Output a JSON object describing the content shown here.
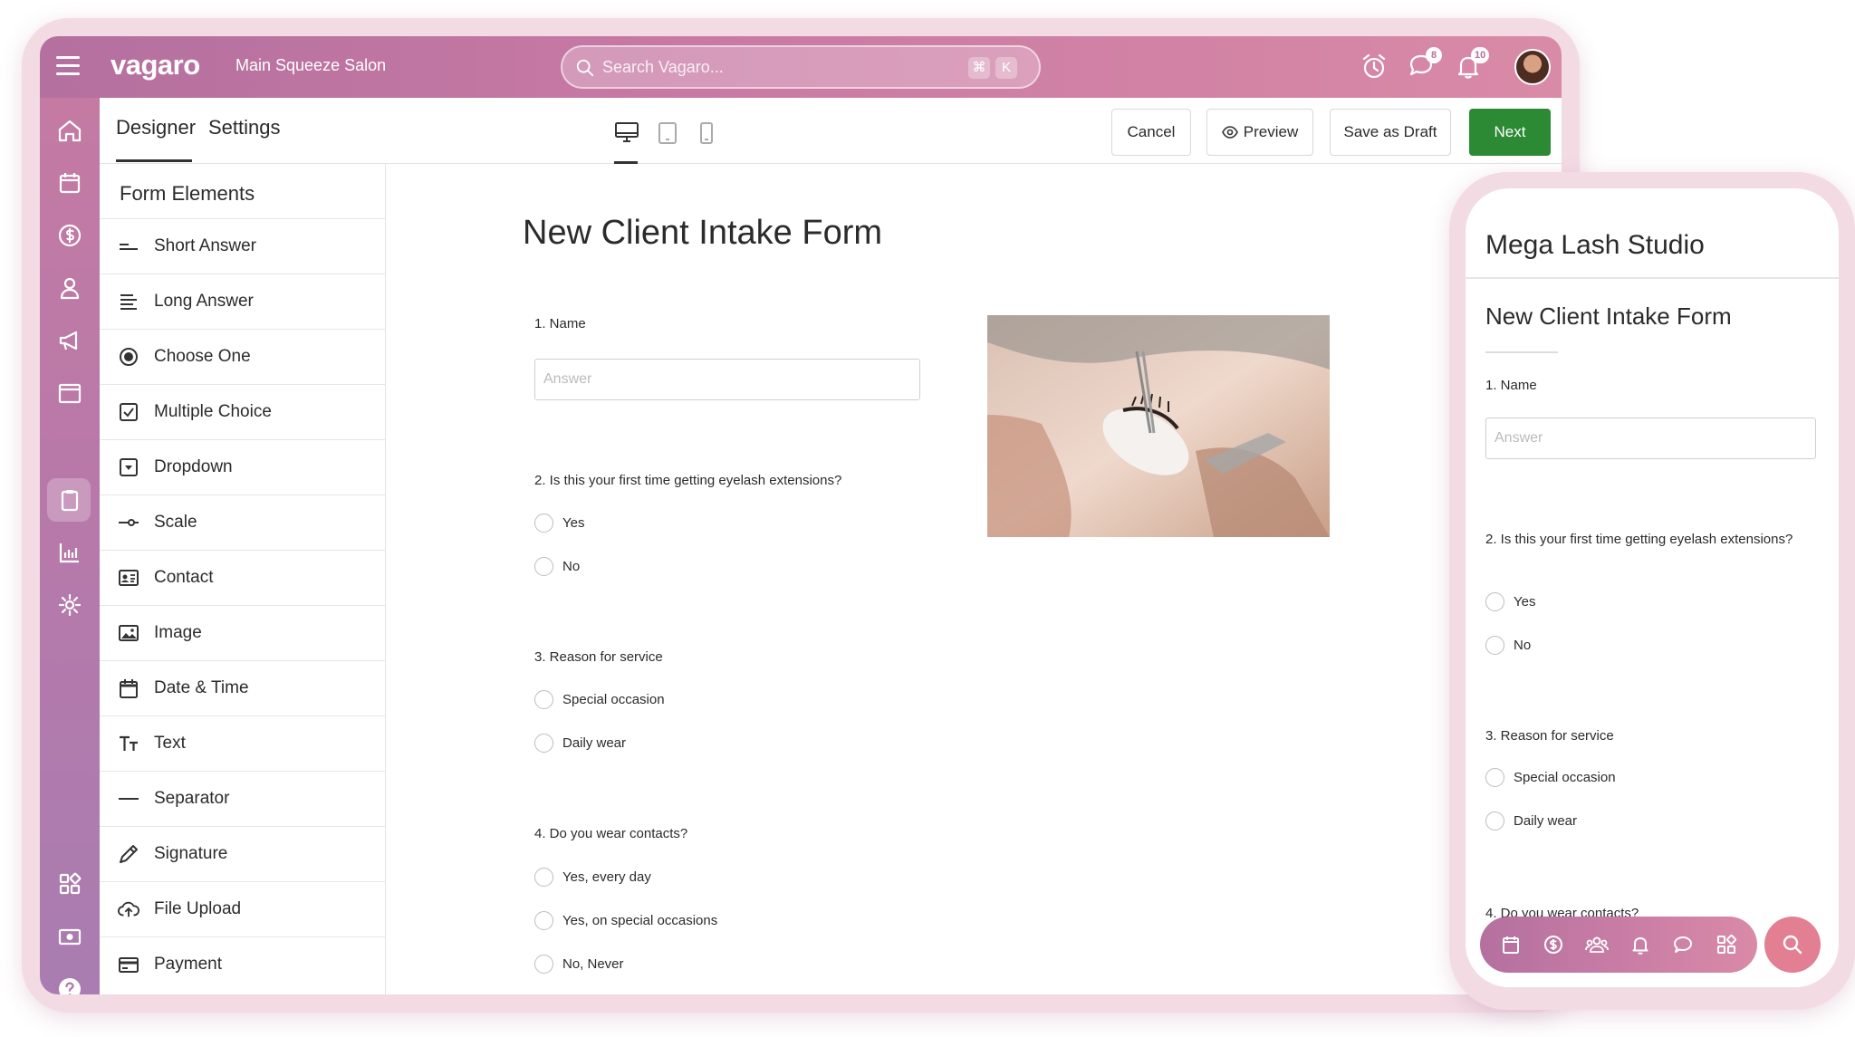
{
  "app": {
    "logo": "vagaro",
    "salon_name": "Main Squeeze Salon",
    "search": {
      "placeholder": "Search Vagaro...",
      "shortcut_keys": [
        "⌘",
        "K"
      ]
    },
    "badges": {
      "messages": "8",
      "notifications": "10"
    },
    "accent_color": "#c47aa3",
    "sidebar_icons": [
      "home-icon",
      "calendar-icon",
      "dollar-icon",
      "user-icon",
      "megaphone-icon",
      "browser-icon",
      "clipboard-icon",
      "chart-icon",
      "gear-icon",
      "apps-icon",
      "cash-icon",
      "help-icon"
    ]
  },
  "header": {
    "tabs": [
      "Designer",
      "Settings"
    ],
    "active_tab": "Designer",
    "device_views": [
      "desktop",
      "tablet",
      "mobile"
    ],
    "active_device": "desktop",
    "buttons": {
      "cancel": "Cancel",
      "preview": "Preview",
      "save_draft": "Save as Draft",
      "next": "Next"
    },
    "next_color": "#2d8a34"
  },
  "form_elements": {
    "title": "Form Elements",
    "items": [
      {
        "label": "Short Answer",
        "icon": "short-answer-icon"
      },
      {
        "label": "Long Answer",
        "icon": "long-answer-icon"
      },
      {
        "label": "Choose One",
        "icon": "radio-icon"
      },
      {
        "label": "Multiple Choice",
        "icon": "checkbox-icon"
      },
      {
        "label": "Dropdown",
        "icon": "dropdown-icon"
      },
      {
        "label": "Scale",
        "icon": "scale-icon"
      },
      {
        "label": "Contact",
        "icon": "contact-icon"
      },
      {
        "label": "Image",
        "icon": "image-icon"
      },
      {
        "label": "Date & Time",
        "icon": "calendar-icon"
      },
      {
        "label": "Text",
        "icon": "text-icon"
      },
      {
        "label": "Separator",
        "icon": "separator-icon"
      },
      {
        "label": "Signature",
        "icon": "pen-icon"
      },
      {
        "label": "File Upload",
        "icon": "cloud-upload-icon"
      },
      {
        "label": "Payment",
        "icon": "credit-card-icon"
      }
    ]
  },
  "form": {
    "title": "New Client Intake Form",
    "answer_placeholder": "Answer",
    "questions": [
      {
        "label": "1. Name",
        "type": "short_answer"
      },
      {
        "label": "2. Is this your first time getting eyelash extensions?",
        "options": [
          "Yes",
          "No"
        ]
      },
      {
        "label": "3. Reason for service",
        "options": [
          "Special occasion",
          "Daily wear"
        ]
      },
      {
        "label": "4. Do you wear contacts?",
        "options": [
          "Yes, every day",
          "Yes, on special occasions",
          "No, Never"
        ]
      }
    ]
  },
  "phone": {
    "studio_name": "Mega Lash Studio",
    "form_title": "New Client Intake Form",
    "q1": "1. Name",
    "q2": "2. Is this your first time getting eyelash extensions?",
    "q3": "3. Reason for service",
    "q4": "4. Do you wear contacts?",
    "nav_icons": [
      "calendar-icon",
      "dollar-icon",
      "people-icon",
      "bell-icon",
      "chat-icon",
      "apps-icon"
    ],
    "search_color": "#e27f92"
  }
}
